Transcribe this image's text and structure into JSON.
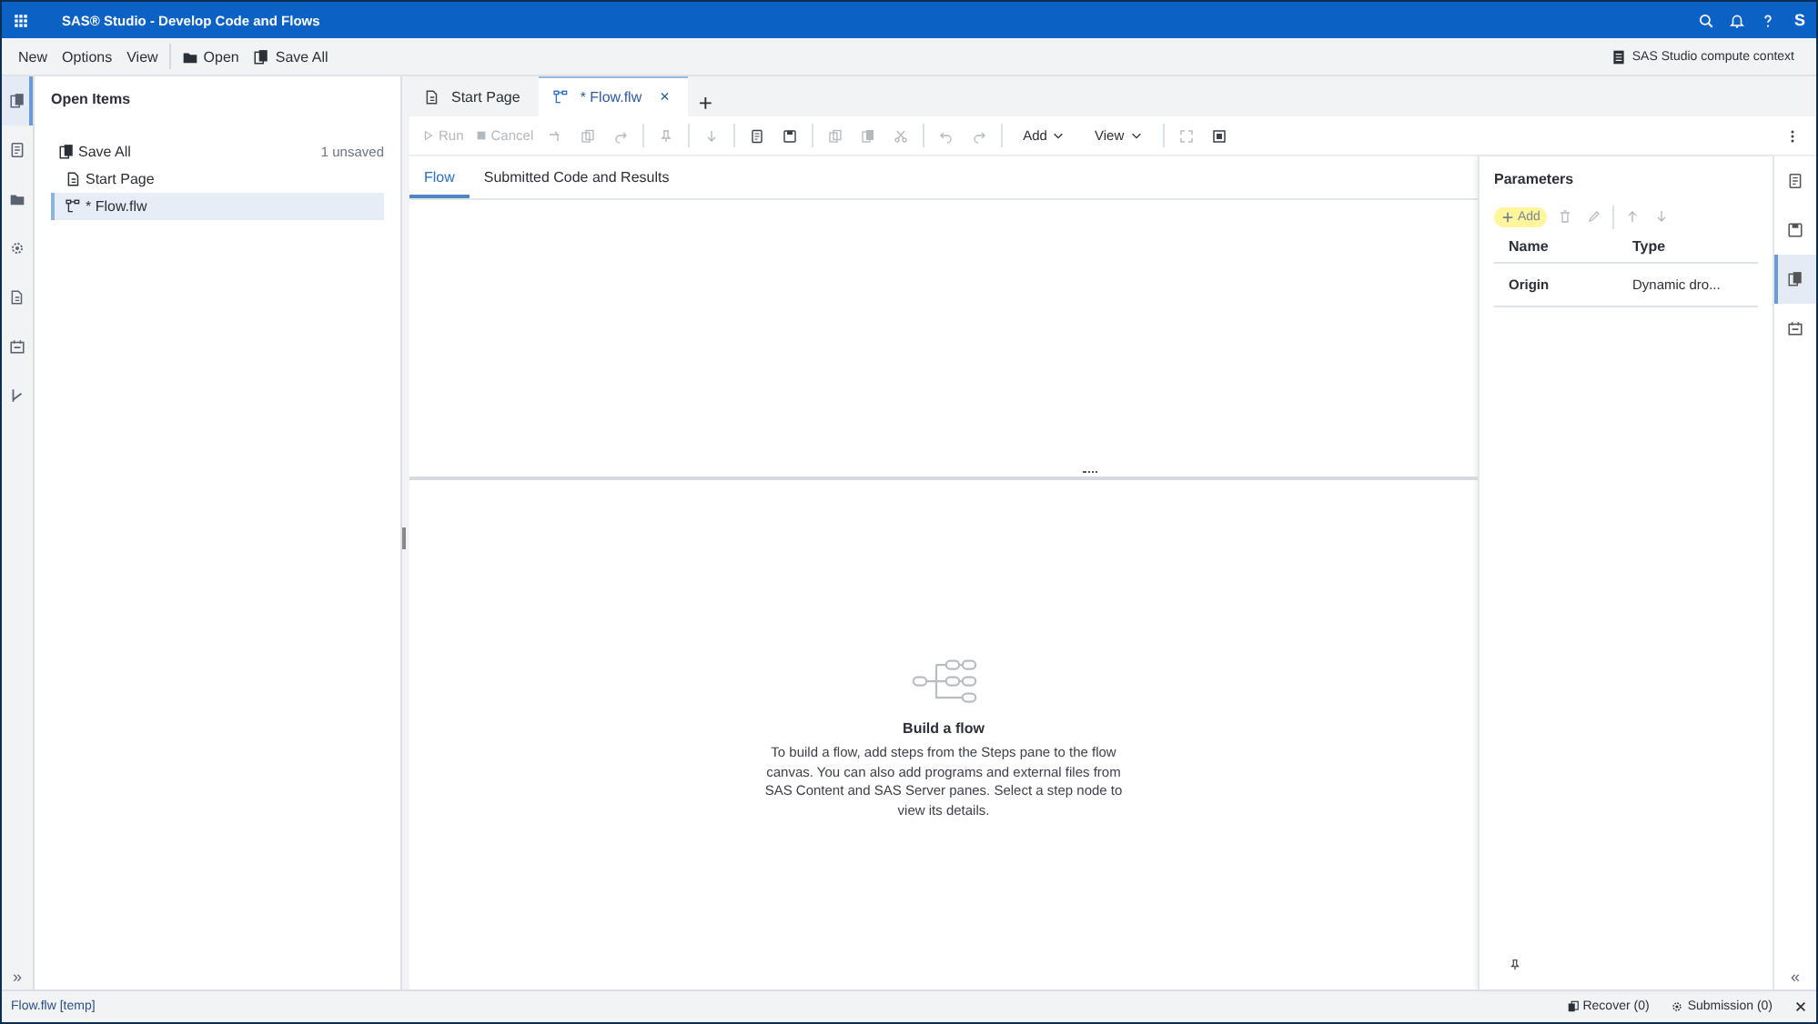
{
  "window": {
    "title": "SAS® Studio - Develop Code and Flows",
    "user_initial": "S"
  },
  "menu": {
    "items": [
      "New",
      "Options",
      "View"
    ],
    "buttons": [
      "Open",
      "Save All"
    ],
    "context": "SAS Studio compute context"
  },
  "left_rail": [
    {
      "selected": true
    },
    {
      "selected": false
    },
    {
      "selected": false
    },
    {
      "selected": false
    },
    {
      "selected": false
    },
    {
      "selected": false
    },
    {
      "selected": false
    }
  ],
  "open_items": {
    "title": "Open Items",
    "save_all": "Save All",
    "unsaved": "1 unsaved",
    "items": [
      {
        "label": "Start Page",
        "kind": "page",
        "selected": false
      },
      {
        "label": "* Flow.flw",
        "kind": "flow",
        "selected": true
      }
    ]
  },
  "editor_tabs": [
    {
      "label": "Start Page",
      "kind": "page",
      "selected": false
    },
    {
      "label": "* Flow.flw",
      "kind": "flow",
      "selected": true,
      "close": "×"
    }
  ],
  "new_tab": "+",
  "toolbar": [
    {
      "kind": "action",
      "label": "Run",
      "disabled": true
    },
    {
      "kind": "action",
      "label": "Cancel",
      "disabled": true
    },
    {
      "kind": "icon",
      "disabled": true
    },
    {
      "kind": "icon",
      "disabled": true
    },
    {
      "kind": "icon",
      "disabled": true
    },
    {
      "kind": "separator"
    },
    {
      "kind": "icon",
      "disabled": true
    },
    {
      "kind": "separator"
    },
    {
      "kind": "icon",
      "disabled": true
    },
    {
      "kind": "separator"
    },
    {
      "kind": "icon",
      "disabled": false
    },
    {
      "kind": "icon",
      "disabled": false
    },
    {
      "kind": "separator"
    },
    {
      "kind": "icon",
      "disabled": true
    },
    {
      "kind": "icon",
      "disabled": true
    },
    {
      "kind": "icon",
      "disabled": true
    },
    {
      "kind": "separator"
    },
    {
      "kind": "icon",
      "disabled": true
    },
    {
      "kind": "icon",
      "disabled": true
    },
    {
      "kind": "separator"
    },
    {
      "kind": "menu",
      "label": "Add",
      "disabled": false
    },
    {
      "kind": "menu",
      "label": "View",
      "disabled": false
    },
    {
      "kind": "separator"
    },
    {
      "kind": "icon",
      "disabled": true
    },
    {
      "kind": "icon",
      "disabled": false
    }
  ],
  "sub_tabs": [
    {
      "label": "Flow",
      "selected": true
    },
    {
      "label": "Submitted Code and Results",
      "selected": false
    }
  ],
  "empty_state": {
    "title": "Build a flow",
    "text": "To build a flow, add steps from the Steps pane to the flow canvas. You can also add programs and external files from SAS Content and SAS Server panes. Select a step node to view its details."
  },
  "parameters": {
    "title": "Parameters",
    "add": "Add",
    "columns": [
      "Name",
      "Type"
    ],
    "rows": [
      {
        "name": "Origin",
        "type": "Dynamic dro..."
      }
    ]
  },
  "right_rail": [
    {
      "selected": false
    },
    {
      "selected": false
    },
    {
      "selected": true
    },
    {
      "selected": false
    }
  ],
  "expand_left": "»",
  "collapse_right": "«",
  "status_bar": {
    "file": "Flow.flw [temp]",
    "recover": "Recover (0)",
    "submission": "Submission (0)"
  }
}
